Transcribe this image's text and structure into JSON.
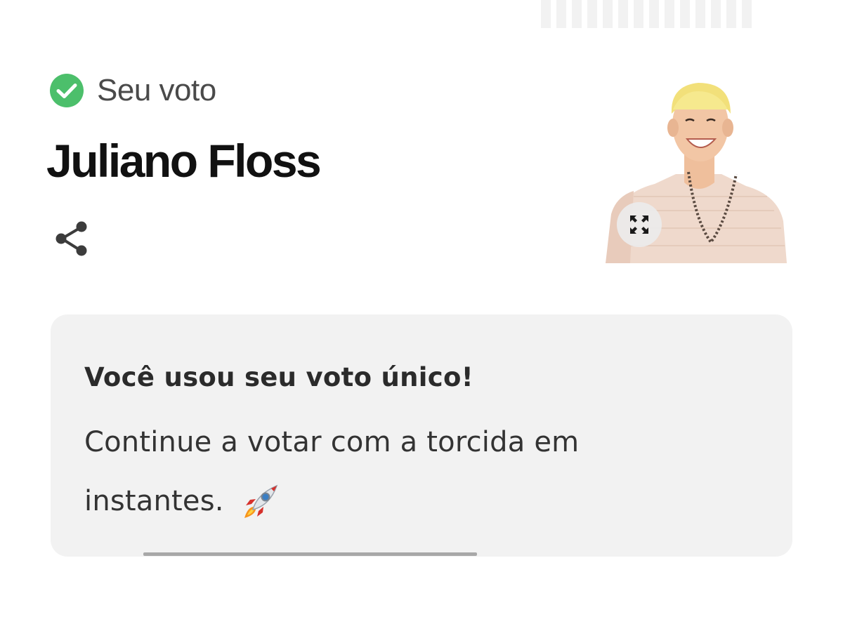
{
  "vote_status": {
    "label": "Seu voto",
    "icon": "check-circle-icon",
    "icon_color": "#4cbf6b"
  },
  "candidate": {
    "name": "Juliano Floss",
    "photo_alt": "Juliano Floss"
  },
  "actions": {
    "share_icon": "share-icon",
    "expand_icon": "expand-icon"
  },
  "info_card": {
    "title": "Você usou seu voto único!",
    "message": "Continue a votar com a torcida em instantes.",
    "emoji_icon": "rocket-icon",
    "background": "#f2f2f2"
  },
  "progress": {
    "value": 0.45
  }
}
